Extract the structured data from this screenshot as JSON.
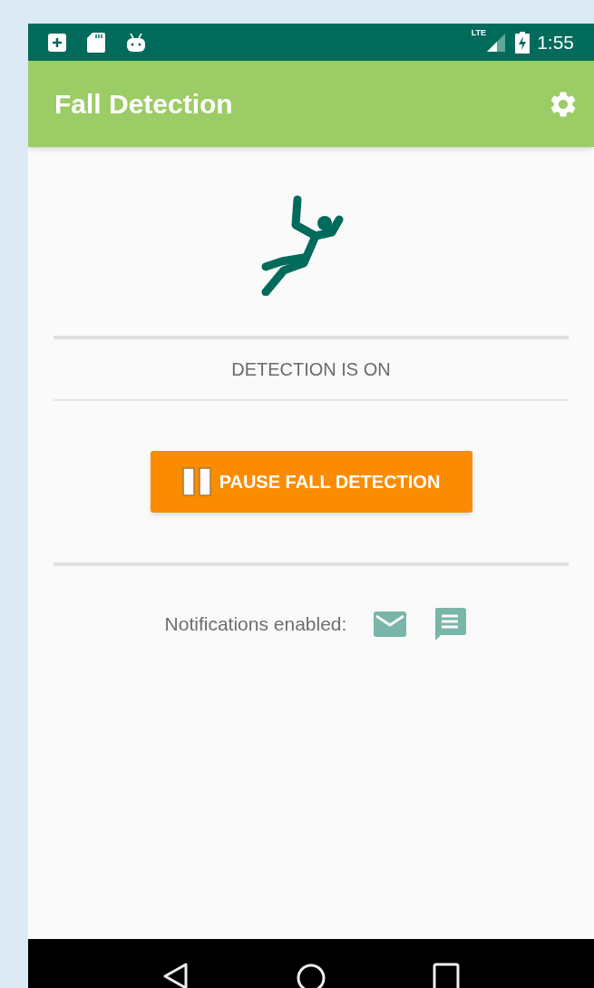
{
  "status_bar": {
    "network": "LTE",
    "time": "1:55"
  },
  "app_bar": {
    "title": "Fall Detection"
  },
  "detection": {
    "status": "DETECTION IS ON"
  },
  "pause_button": {
    "label": "PAUSE FALL DETECTION"
  },
  "notifications": {
    "label": "Notifications enabled:"
  }
}
